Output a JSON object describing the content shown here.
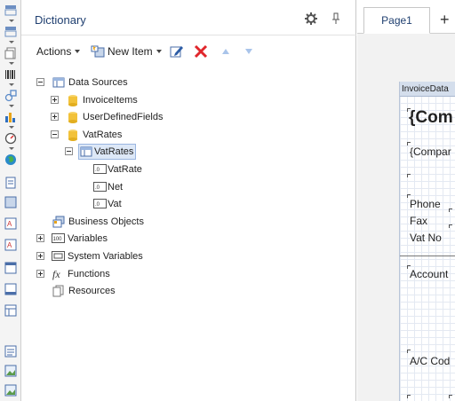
{
  "dictionary": {
    "title": "Dictionary",
    "toolbar": {
      "actions_label": "Actions",
      "new_item_label": "New Item"
    },
    "tree": {
      "data_sources": "Data Sources",
      "invoice_items": "InvoiceItems",
      "user_defined_fields": "UserDefinedFields",
      "vat_rates_source": "VatRates",
      "vat_rates_table": "VatRates",
      "columns": [
        "VatRate",
        "Net",
        "Vat"
      ],
      "business_objects": "Business Objects",
      "variables": "Variables",
      "system_variables": "System Variables",
      "functions": "Functions",
      "resources": "Resources"
    }
  },
  "designer": {
    "tabs": [
      "Page1"
    ],
    "add_tab_glyph": "+",
    "band_name": "InvoiceData",
    "texts": [
      "{Com",
      "{Compar",
      "Phone",
      "Fax",
      "Vat No",
      "Account",
      "A/C Cod"
    ]
  },
  "colors": {
    "accent": "#1f3f70",
    "delete_red": "#e0262b",
    "database_yellow": "#f2c23a",
    "selection": "#dde8f7"
  },
  "icons": {
    "toolbox": [
      "report-icon",
      "page-icon",
      "data-icon",
      "barcode-icon",
      "shapes-icon",
      "chart-icon",
      "gauge-icon",
      "map-icon",
      "text-icon",
      "panel-icon",
      "text-box-icon",
      "image-icon",
      "band-header-icon",
      "band-footer-icon",
      "table-icon",
      "rich-text-icon",
      "picture-icon"
    ]
  }
}
